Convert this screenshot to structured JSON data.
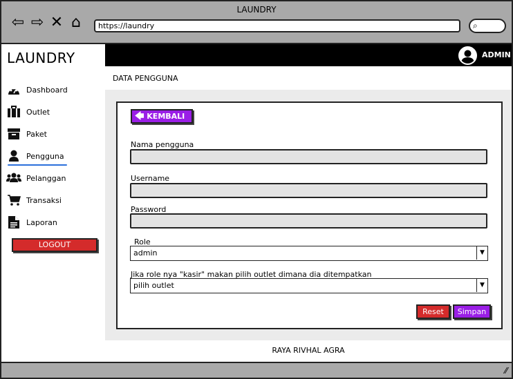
{
  "window": {
    "title": "LAUNDRY",
    "url": "https://laundry"
  },
  "sidebar": {
    "brand": "LAUNDRY",
    "items": [
      {
        "label": "Dashboard",
        "icon": "dashboard-icon"
      },
      {
        "label": "Outlet",
        "icon": "outlet-icon"
      },
      {
        "label": "Paket",
        "icon": "box-icon"
      },
      {
        "label": "Pengguna",
        "icon": "user-icon",
        "active": true
      },
      {
        "label": "Pelanggan",
        "icon": "users-icon"
      },
      {
        "label": "Transaksi",
        "icon": "cart-icon"
      },
      {
        "label": "Laporan",
        "icon": "file-icon"
      }
    ],
    "logout_label": "LOGOUT"
  },
  "header": {
    "user_label": "ADMIN"
  },
  "page": {
    "title": "DATA PENGGUNA"
  },
  "form": {
    "back_label": "KEMBALI",
    "name_label": "Nama pengguna",
    "name_value": "",
    "username_label": "Username",
    "username_value": "",
    "password_label": "Password",
    "password_value": "",
    "role_label": "Role",
    "role_value": "admin",
    "outlet_label": "Jika role nya \"kasir\" makan pilih outlet dimana dia ditempatkan",
    "outlet_value": "pilih outlet",
    "reset_label": "Reset",
    "save_label": "Simpan"
  },
  "footer": {
    "text": "RAYA RIVHAL AGRA"
  },
  "colors": {
    "accent": "#9a1ee6",
    "danger": "#d42b2b",
    "topbar": "#000000",
    "chrome": "#a9a9a9"
  }
}
